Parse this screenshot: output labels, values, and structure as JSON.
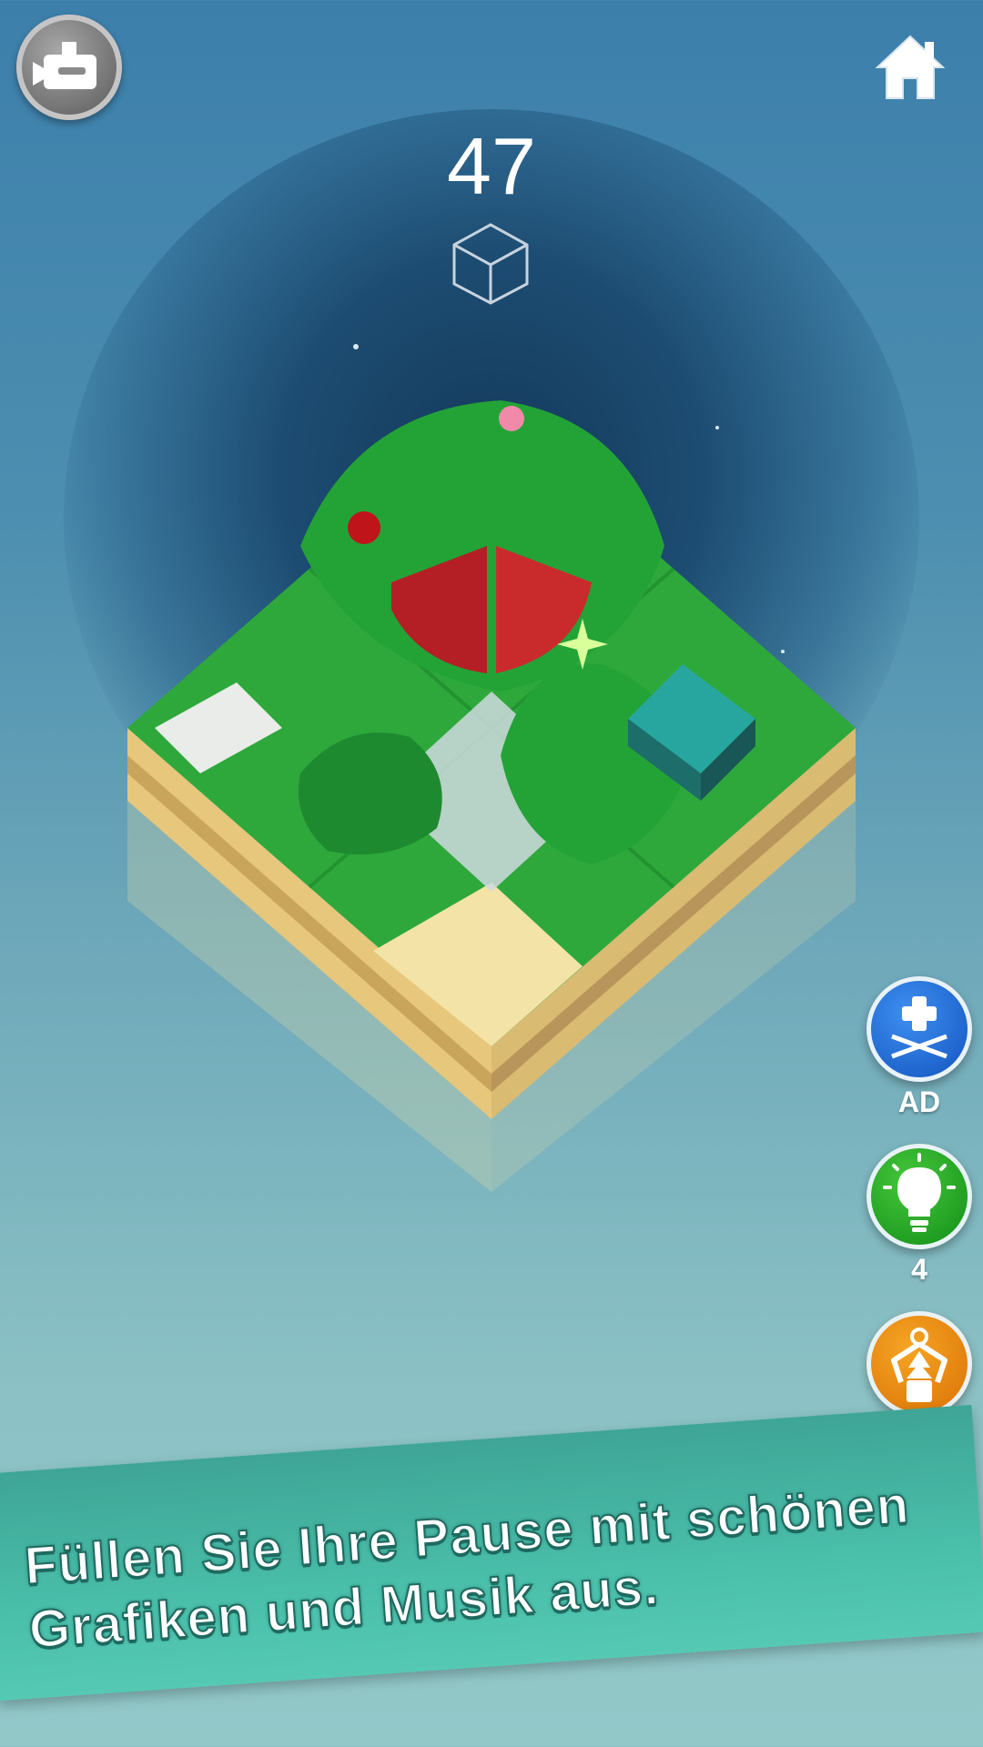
{
  "game": {
    "score": "47",
    "icons": {
      "camera": "video-camera-icon",
      "home": "home-icon",
      "cube": "cube-outline-icon"
    }
  },
  "side_buttons": {
    "move": {
      "icon": "move-arrows-plus-icon",
      "label": "AD",
      "color": "#2a78e0"
    },
    "hint": {
      "icon": "lightbulb-icon",
      "label": "4",
      "color": "#2fb22c"
    },
    "tree": {
      "icon": "claw-tree-icon",
      "color": "#ee8f14"
    }
  },
  "banner": {
    "line1": "Füllen Sie Ihre Pause mit schönen",
    "line2": "Grafiken und Musik aus.",
    "color": "#4bbfa9"
  }
}
